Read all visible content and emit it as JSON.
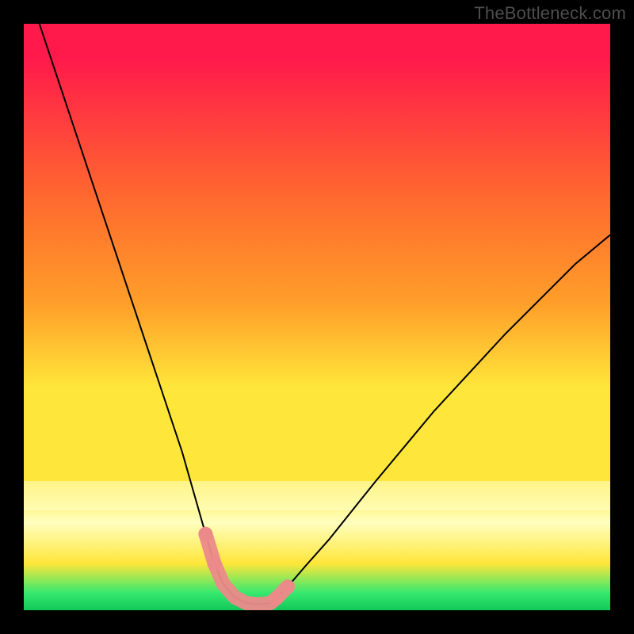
{
  "watermark": "TheBottleneck.com",
  "colors": {
    "top": "#ff1a4b",
    "mid_red_orange": "#ff6a2e",
    "orange": "#ffa02a",
    "yellow": "#ffe63a",
    "pale_yellow": "#ffffbf",
    "green": "#37e96e",
    "deep_green": "#12c85a",
    "curve": "#000000",
    "marker": "#ec8a8a",
    "frame": "#000000"
  },
  "chart_data": {
    "type": "line",
    "title": "",
    "xlabel": "",
    "ylabel": "",
    "xlim": [
      0,
      100
    ],
    "ylim": [
      0,
      100
    ],
    "curve": {
      "x": [
        0,
        3,
        6,
        9,
        12,
        15,
        18,
        21,
        24,
        27,
        29,
        31,
        32.5,
        34,
        36,
        38,
        40,
        42,
        43,
        45,
        48,
        52,
        56,
        60,
        65,
        70,
        76,
        82,
        88,
        94,
        100
      ],
      "y": [
        108,
        99,
        90,
        81,
        72,
        63,
        54,
        45,
        36,
        27,
        20,
        13,
        8,
        4.5,
        2.2,
        1.2,
        1.0,
        1.2,
        2.0,
        4.0,
        7.5,
        12,
        17,
        22,
        28,
        34,
        40.5,
        47,
        53,
        59,
        64
      ]
    },
    "highlight_segment": {
      "x": [
        31,
        32.5,
        34,
        36,
        38,
        40,
        42,
        43,
        45
      ],
      "y": [
        13,
        8,
        4.5,
        2.2,
        1.2,
        1.0,
        1.2,
        2.0,
        4.0
      ]
    },
    "gradient_stops_pct": [
      0,
      30,
      48,
      62,
      78,
      85,
      92,
      97,
      100
    ],
    "yellow_band_y": [
      17,
      22
    ]
  }
}
